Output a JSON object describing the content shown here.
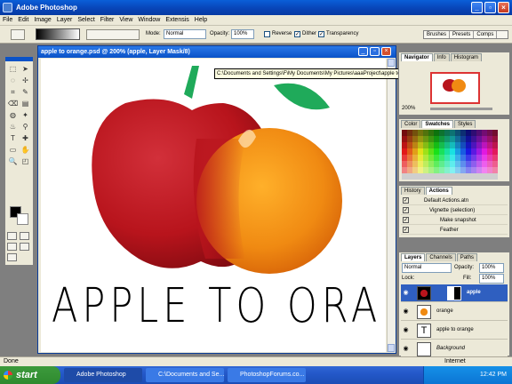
{
  "window": {
    "title": "Adobe Photoshop"
  },
  "menu": [
    "File",
    "Edit",
    "Image",
    "Layer",
    "Select",
    "Filter",
    "View",
    "Window",
    "Extensis",
    "Help"
  ],
  "options": {
    "mode_label": "Mode:",
    "mode_value": "Normal",
    "opacity_label": "Opacity:",
    "opacity_value": "100%",
    "reverse": "Reverse",
    "dither": "Dither",
    "transparency": "Transparency",
    "wells": [
      "Brushes",
      "Presets",
      "Comps"
    ]
  },
  "document": {
    "title": "apple to orange.psd @ 200% (apple, Layer Mask/8)",
    "headline": "APPLE TO ORANGE"
  },
  "tooltip": "C:\\Documents and Settings\\F\\My Documents\\My Pictures\\aaaProject\\apple to orange.psd @ 200% (apple, Layer Mask/8)",
  "navigator": {
    "tabs": [
      "Navigator",
      "Info",
      "Histogram"
    ],
    "zoom": "200%"
  },
  "swatches": {
    "tabs": [
      "Color",
      "Swatches",
      "Styles"
    ]
  },
  "actions": {
    "tabs": [
      "History",
      "Actions"
    ],
    "items": [
      "Default Actions.atn",
      "Vignette (selection)",
      "Make snapshot",
      "Feather"
    ]
  },
  "layers": {
    "tabs": [
      "Layers",
      "Channels",
      "Paths"
    ],
    "blend": "Normal",
    "opacity_label": "Opacity:",
    "opacity_value": "100%",
    "lock_label": "Lock:",
    "fill_label": "Fill:",
    "fill_value": "100%",
    "rows": [
      {
        "name": "apple",
        "selected": true
      },
      {
        "name": "orange"
      },
      {
        "name": "apple to orange",
        "type_layer": "T"
      },
      {
        "name": "Background"
      }
    ]
  },
  "status": {
    "text": "Done",
    "zone": "Internet"
  },
  "taskbar": {
    "start": "start",
    "items": [
      "Adobe Photoshop",
      "C:\\Documents and Se...",
      "PhotoshopForums.co..."
    ],
    "clock": "12:42 PM"
  },
  "colors": {
    "apple": "#b8141c",
    "orange": "#f08a12",
    "leaf": "#1faa5a",
    "selection": "#2f5fc0"
  }
}
